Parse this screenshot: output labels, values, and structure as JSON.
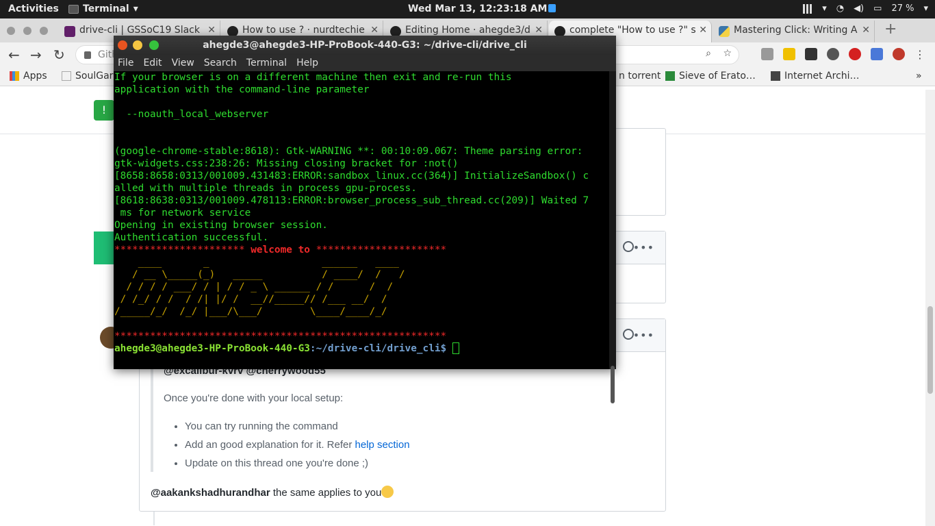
{
  "topbar": {
    "activities": "Activities",
    "app_name": "Terminal",
    "clock": "Wed Mar 13, 12:23:18 AM",
    "battery": "27 %"
  },
  "tabs": [
    {
      "label": "drive-cli | GSSoC19 Slack",
      "favicon": "slack-icon"
    },
    {
      "label": "How to use ? · nurdtechie",
      "favicon": "github-icon"
    },
    {
      "label": "Editing Home · ahegde3/d",
      "favicon": "github-icon"
    },
    {
      "label": "complete \"How to use ?\" s",
      "favicon": "github-icon"
    },
    {
      "label": "Mastering Click: Writing A",
      "favicon": "python-icon"
    }
  ],
  "omnibox": {
    "text": "Gith"
  },
  "bookmarks": [
    {
      "label": "Apps"
    },
    {
      "label": "SoulGar"
    },
    {
      "label": "n torrent"
    },
    {
      "label": "Sieve of Erato…"
    },
    {
      "label": "Internet Archi…"
    }
  ],
  "terminal": {
    "title": "ahegde3@ahegde3-HP-ProBook-440-G3: ~/drive-cli/drive_cli",
    "menu": [
      "File",
      "Edit",
      "View",
      "Search",
      "Terminal",
      "Help"
    ],
    "lines": [
      "If your browser is on a different machine then exit and re-run this",
      "application with the command-line parameter",
      "",
      "  --noauth_local_webserver",
      "",
      "",
      "(google-chrome-stable:8618): Gtk-WARNING **: 00:10:09.067: Theme parsing error:",
      "gtk-widgets.css:238:26: Missing closing bracket for :not()",
      "[8658:8658:0313/001009.431483:ERROR:sandbox_linux.cc(364)] InitializeSandbox() c",
      "alled with multiple threads in process gpu-process.",
      "[8618:8638:0313/001009.478113:ERROR:browser_process_sub_thread.cc(209)] Waited 7",
      " ms for network service",
      "Opening in existing browser session.",
      "Authentication successful."
    ],
    "stars_left": "**********************",
    "welcome": " welcome to ",
    "stars_right": "**********************",
    "ascii_art": [
      "    ____       _                   ______   ____",
      "   / __ \\_____(_)   _____          / ____/  /   /",
      "  / / / / ___/ / | / / _ \\ ______ / /      /  /",
      " / /_/ / /  / /| |/ /  __//_____// /___ __/  /",
      "/_____/_/  /_/ |___/\\___/        \\____/____/_/"
    ],
    "stars_full": "********************************************************",
    "prompt_user": "ahegde3@ahegde3-HP-ProBook-440-G3",
    "prompt_path": ":~/drive-cli/drive_cli",
    "prompt_symbol": "$ "
  },
  "github": {
    "mentions": "@excalibur-kvrv @cherrywood55",
    "setup_line": "Once you're done with your local setup:",
    "list": [
      {
        "text": "You can try running the command",
        "link": ""
      },
      {
        "text": "Add an good explanation for it. Refer ",
        "link": "help section"
      },
      {
        "text": "Update on this thread one you're done ;)",
        "link": ""
      }
    ],
    "reply_user": "@aakankshadhurandhar",
    "reply_text": " the same applies to you"
  }
}
